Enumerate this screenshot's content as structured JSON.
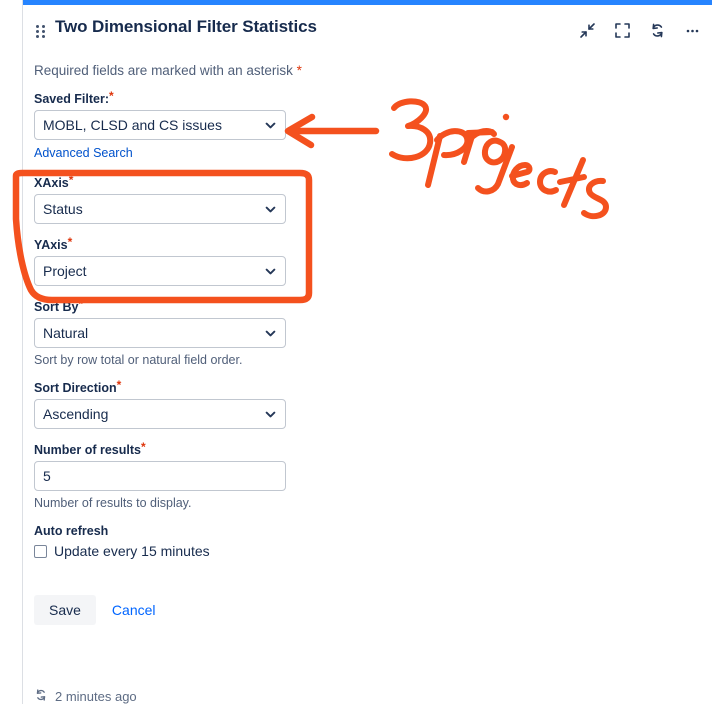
{
  "gadget": {
    "title": "Two Dimensional Filter Statistics",
    "required_note": "Required fields are marked with an asterisk",
    "required_asterisk": "*",
    "accent_color": "#2684ff",
    "header_icons": [
      {
        "name": "collapse-icon",
        "label": "Collapse"
      },
      {
        "name": "maximize-icon",
        "label": "Maximize"
      },
      {
        "name": "refresh-icon",
        "label": "Refresh"
      },
      {
        "name": "more-options-icon",
        "label": "More"
      }
    ]
  },
  "form": {
    "saved_filter": {
      "label": "Saved Filter:",
      "required": "*",
      "value": "MOBL, CLSD and CS issues",
      "options": [
        "MOBL, CLSD and CS issues"
      ]
    },
    "advanced_search_link": "Advanced Search",
    "x_axis": {
      "label": "XAxis",
      "required": "*",
      "value": "Status",
      "options": [
        "Status"
      ]
    },
    "y_axis": {
      "label": "YAxis",
      "required": "*",
      "value": "Project",
      "options": [
        "Project"
      ]
    },
    "sort_by": {
      "label": "Sort By",
      "required": "*",
      "value": "Natural",
      "options": [
        "Natural"
      ],
      "help": "Sort by row total or natural field order."
    },
    "sort_direction": {
      "label": "Sort Direction",
      "required": "*",
      "value": "Ascending",
      "options": [
        "Ascending"
      ]
    },
    "number_of_results": {
      "label": "Number of results",
      "required": "*",
      "value": "5",
      "placeholder": "",
      "help": "Number of results to display."
    },
    "auto_refresh": {
      "label": "Auto refresh",
      "checkbox_label": "Update every 15 minutes",
      "checked": false
    },
    "save_button": "Save",
    "cancel_link": "Cancel"
  },
  "footer": {
    "refresh_icon": "refresh-icon",
    "timestamp": "2 minutes ago"
  },
  "annotations": {
    "ink_color": "#f4511e",
    "handwritten_text": "3 projects",
    "arrow": "left-pointing arrow to Saved Filter dropdown",
    "rectangle": "orange rectangle around XAxis and YAxis fields"
  }
}
